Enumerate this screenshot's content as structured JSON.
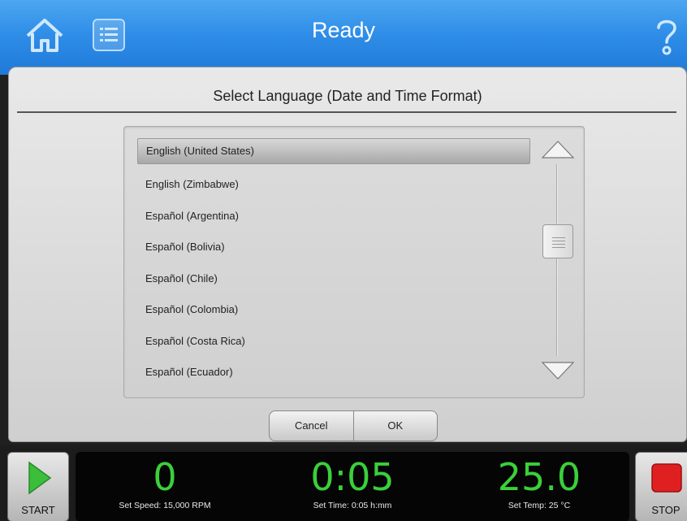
{
  "header": {
    "title": "Ready"
  },
  "dialog": {
    "title": "Select Language (Date and Time Format)",
    "languages": [
      "English (United States)",
      "English (Zimbabwe)",
      "Español (Argentina)",
      "Español (Bolivia)",
      "Español (Chile)",
      "Español (Colombia)",
      "Español (Costa Rica)",
      "Español (Ecuador)"
    ],
    "selected": "English (United States)",
    "cancel_label": "Cancel",
    "ok_label": "OK"
  },
  "footer": {
    "start_label": "START",
    "stop_label": "STOP",
    "speed": {
      "value": "0",
      "label": "Set Speed: 15,000 RPM"
    },
    "time": {
      "value": "0:05",
      "label": "Set Time: 0:05 h:mm"
    },
    "temp": {
      "value": "25.0",
      "label": "Set Temp: 25 °C"
    }
  },
  "colors": {
    "header": "#2f8ee8",
    "readout": "#3ad03a",
    "start_icon": "#3bbf3b",
    "stop_icon": "#e02020"
  },
  "icons": [
    "home-icon",
    "list-icon",
    "help-icon",
    "scroll-up-icon",
    "scroll-down-icon",
    "play-icon",
    "stop-icon"
  ]
}
